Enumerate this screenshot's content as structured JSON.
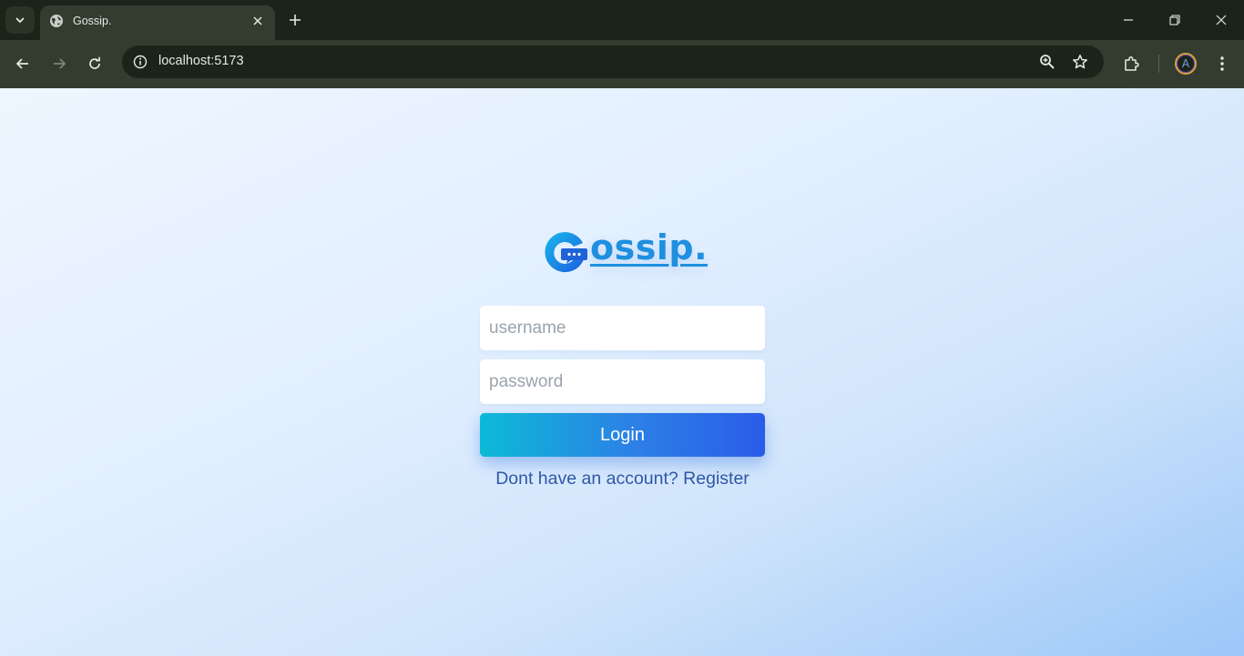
{
  "browser": {
    "tab": {
      "title": "Gossip."
    },
    "address": {
      "url": "localhost:5173"
    },
    "profile_initial": "A",
    "icons": {
      "tab_menu": "chevron-down-icon",
      "favicon": "globe-icon",
      "tab_close": "close-icon",
      "new_tab": "plus-icon",
      "minimize": "minimize-icon",
      "restore": "restore-icon",
      "close": "close-icon",
      "back": "arrow-left-icon",
      "forward": "arrow-right-icon",
      "reload": "reload-icon",
      "site_info": "info-icon",
      "zoom": "zoom-icon",
      "bookmark": "star-icon",
      "extensions": "puzzle-icon",
      "menu": "kebab-icon"
    }
  },
  "page": {
    "logo_text": "ossip.",
    "logo_full": "Gossip.",
    "username": {
      "placeholder": "username",
      "value": ""
    },
    "password": {
      "placeholder": "password",
      "value": ""
    },
    "login_label": "Login",
    "register_prompt": "Dont have an account? ",
    "register_link": "Register"
  },
  "colors": {
    "chrome_dark": "#1b2418",
    "chrome_toolbar": "#333c2f",
    "brand_blue": "#1f8fe0",
    "button_gradient_start": "#0cbad6",
    "button_gradient_end": "#2b5ce8",
    "link": "#2f57a8"
  }
}
